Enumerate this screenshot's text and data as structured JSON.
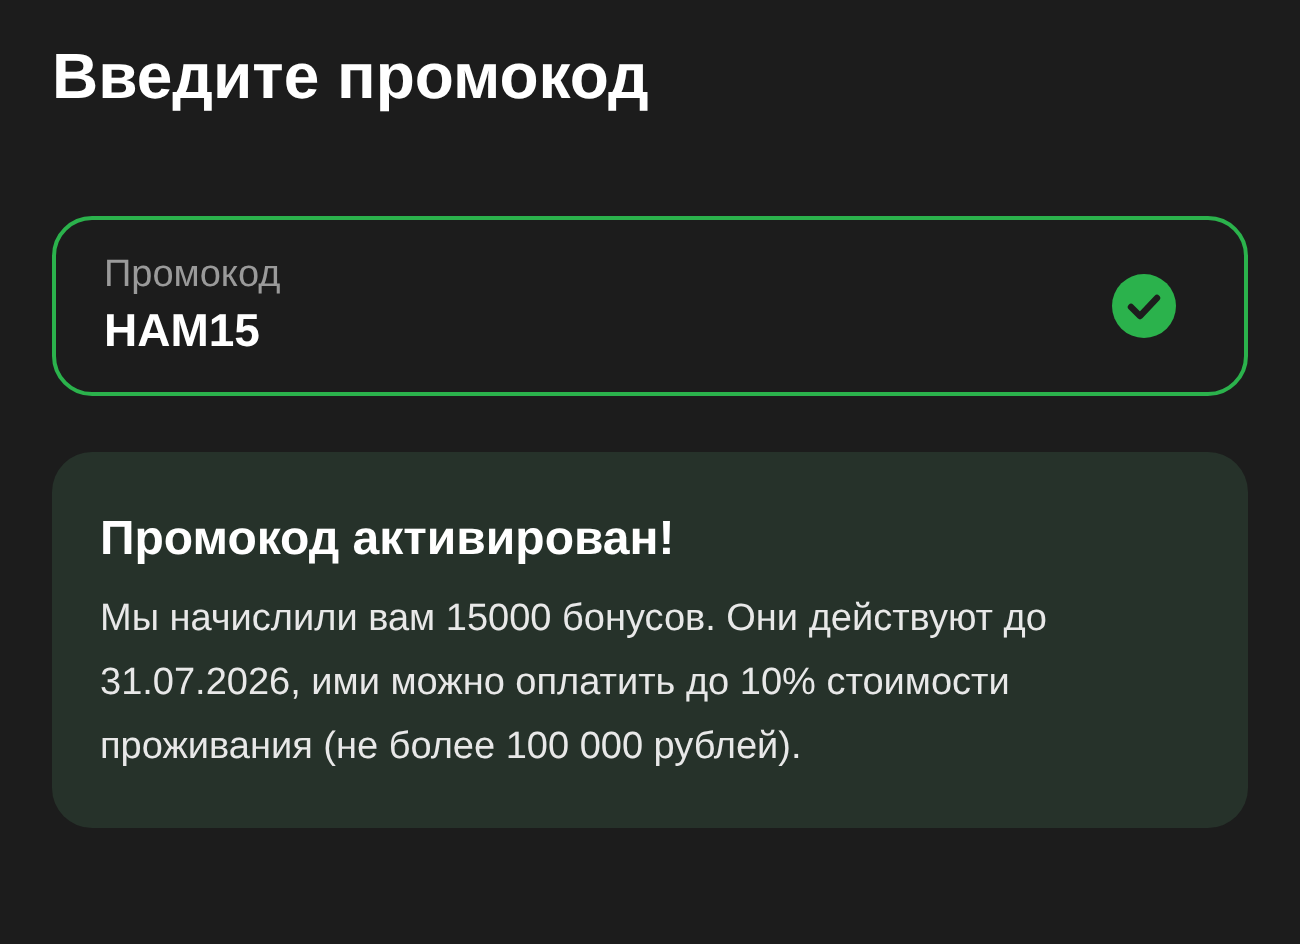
{
  "title": "Введите промокод",
  "promo_field": {
    "label": "Промокод",
    "value": "HAM15",
    "valid": true
  },
  "notice": {
    "title": "Промокод активирован!",
    "text": "Мы начислили вам 15000 бонусов. Они действуют до 31.07.2026, ими можно оплатить до 10% стоимости проживания (не более 100 000 рублей)."
  }
}
